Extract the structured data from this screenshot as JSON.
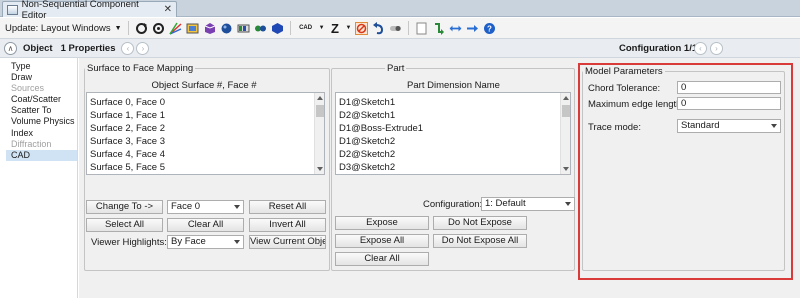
{
  "window": {
    "tab_title": "Non-Sequential Component Editor",
    "close_glyph": "✕"
  },
  "toolbar": {
    "update_label": "Update: Layout Windows",
    "icons": [
      "refresh-icon",
      "refresh-all-icon",
      "ray-trace-icon",
      "object-editor-icon",
      "cube-icon",
      "lens-icon",
      "sphere-icon",
      "color-icon",
      "cad-icon",
      "z-icon",
      "no-entry-icon",
      "undo-icon",
      "toggle-icon",
      "copy-icon",
      "arrows-icon",
      "left-right-icon",
      "arrow-right-icon",
      "help-icon"
    ],
    "cad_label": "CAD",
    "z_label": "Z"
  },
  "object_row": {
    "object_label": "Object",
    "properties_label": "1 Properties",
    "configuration_label": "Configuration 1/1"
  },
  "nav": {
    "items": [
      {
        "label": "Type",
        "state": "normal"
      },
      {
        "label": "Draw",
        "state": "normal"
      },
      {
        "label": "Sources",
        "state": "disabled"
      },
      {
        "label": "Coat/Scatter",
        "state": "normal"
      },
      {
        "label": "Scatter To",
        "state": "normal"
      },
      {
        "label": "Volume Physics",
        "state": "normal"
      },
      {
        "label": "Index",
        "state": "normal"
      },
      {
        "label": "Diffraction",
        "state": "disabled"
      },
      {
        "label": "CAD",
        "state": "selected"
      }
    ]
  },
  "surface_mapping": {
    "title": "Surface to Face Mapping",
    "column_header": "Object Surface #, Face #",
    "rows": [
      "Surface 0, Face 0",
      "Surface 1, Face 1",
      "Surface 2, Face 2",
      "Surface 3, Face 3",
      "Surface 4, Face 4",
      "Surface 5, Face 5"
    ],
    "change_to_label": "Change To ->",
    "face_select_value": "Face 0",
    "reset_all_label": "Reset All",
    "select_all_label": "Select All",
    "clear_all_label": "Clear All",
    "invert_all_label": "Invert All",
    "viewer_highlights_label": "Viewer Highlights:",
    "viewer_highlights_value": "By Face",
    "view_current_object_label": "View Current Object"
  },
  "part": {
    "title": "Part",
    "column_header": "Part Dimension Name",
    "rows": [
      "D1@Sketch1",
      "D2@Sketch1",
      "D1@Boss-Extrude1",
      "D1@Sketch2",
      "D2@Sketch2",
      "D3@Sketch2"
    ],
    "configuration_label": "Configuration:",
    "configuration_value": "1: Default",
    "expose_label": "Expose",
    "do_not_expose_label": "Do Not Expose",
    "expose_all_label": "Expose All",
    "do_not_expose_all_label": "Do Not Expose All",
    "clear_all_label": "Clear All"
  },
  "model_parameters": {
    "title": "Model Parameters",
    "chord_tolerance_label": "Chord Tolerance:",
    "chord_tolerance_value": "0",
    "max_edge_length_label": "Maximum edge length:",
    "max_edge_length_value": "0",
    "trace_mode_label": "Trace mode:",
    "trace_mode_value": "Standard",
    "highlight_color": "#d93a3a"
  }
}
